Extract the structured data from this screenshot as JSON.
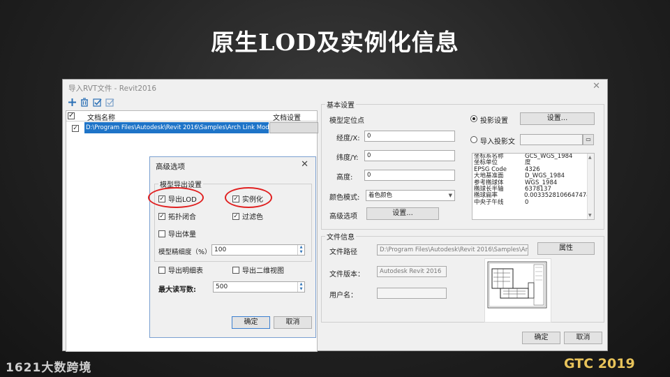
{
  "slide": {
    "title": "原生LOD及实例化信息",
    "logo_left": "1621大数跨境",
    "logo_right": "GTC 2019"
  },
  "window": {
    "title": "导入RVT文件 - Revit2016",
    "close_glyph": "✕"
  },
  "toolbar": {
    "icons": [
      "add-icon",
      "delete-icon",
      "check-all-icon",
      "uncheck-icon"
    ]
  },
  "file_list": {
    "columns": [
      "文档名称",
      "文档设置"
    ],
    "rows": [
      {
        "checked": true,
        "path": "D:\\Program Files\\Autodesk\\Revit 2016\\Samples\\Arch Link Model.rvt",
        "setting": ""
      }
    ]
  },
  "basic_settings": {
    "group_label": "基本设置",
    "location_label": "模型定位点",
    "longitude_label": "经度/X:",
    "longitude_value": "0",
    "latitude_label": "纬度/Y:",
    "latitude_value": "0",
    "height_label": "高度:",
    "height_value": "0",
    "color_mode_label": "颜色模式:",
    "color_mode_value": "着色颜色",
    "advanced_label": "高级选项",
    "advanced_button": "设置...",
    "projection_radio": "投影设置",
    "projection_button": "设置...",
    "import_projection_radio": "导入投影文",
    "import_projection_value": "",
    "info": [
      {
        "k": "坐标系名称",
        "v": "GCS_WGS_1984"
      },
      {
        "k": "坐标单位",
        "v": "度"
      },
      {
        "k": "EPSG Code",
        "v": "4326"
      },
      {
        "k": "大地基准面",
        "v": "D_WGS_1984"
      },
      {
        "k": "参考椭球体",
        "v": "WGS_1984"
      },
      {
        "k": "椭球长半轴",
        "v": "6378137"
      },
      {
        "k": "椭球扁率",
        "v": "0.00335281066474748"
      },
      {
        "k": "中央子午线",
        "v": "0"
      }
    ]
  },
  "file_info": {
    "group_label": "文件信息",
    "path_label": "文件路径",
    "path_value": "D:\\Program Files\\Autodesk\\Revit 2016\\Samples\\Arch Lin",
    "properties_button": "属性",
    "version_label": "文件版本：",
    "version_value": "Autodesk Revit 2016",
    "username_label": "用户名：",
    "username_value": ""
  },
  "footer": {
    "ok_button": "确定",
    "cancel_button": "取消"
  },
  "advanced_dialog": {
    "title": "高级选项",
    "group_label": "模型导出设置",
    "export_lod": {
      "label": "导出LOD",
      "checked": true
    },
    "instancing": {
      "label": "实例化",
      "checked": true
    },
    "topology_close": {
      "label": "拓扑闭合",
      "checked": true
    },
    "filter_color": {
      "label": "过滤色",
      "checked": true
    },
    "export_volume": {
      "label": "导出体量",
      "checked": false
    },
    "precision_label": "模型精细度（%）:",
    "precision_value": "100",
    "export_schedule": {
      "label": "导出明细表",
      "checked": false
    },
    "export_2d": {
      "label": "导出二维视图",
      "checked": false
    },
    "max_rw_label": "最大读写数:",
    "max_rw_value": "500",
    "ok_button": "确定",
    "cancel_button": "取消"
  },
  "colors": {
    "highlight_ellipse": "#e02020",
    "selection_blue": "#1e74c8",
    "gtc_gold": "#e8c35a"
  }
}
